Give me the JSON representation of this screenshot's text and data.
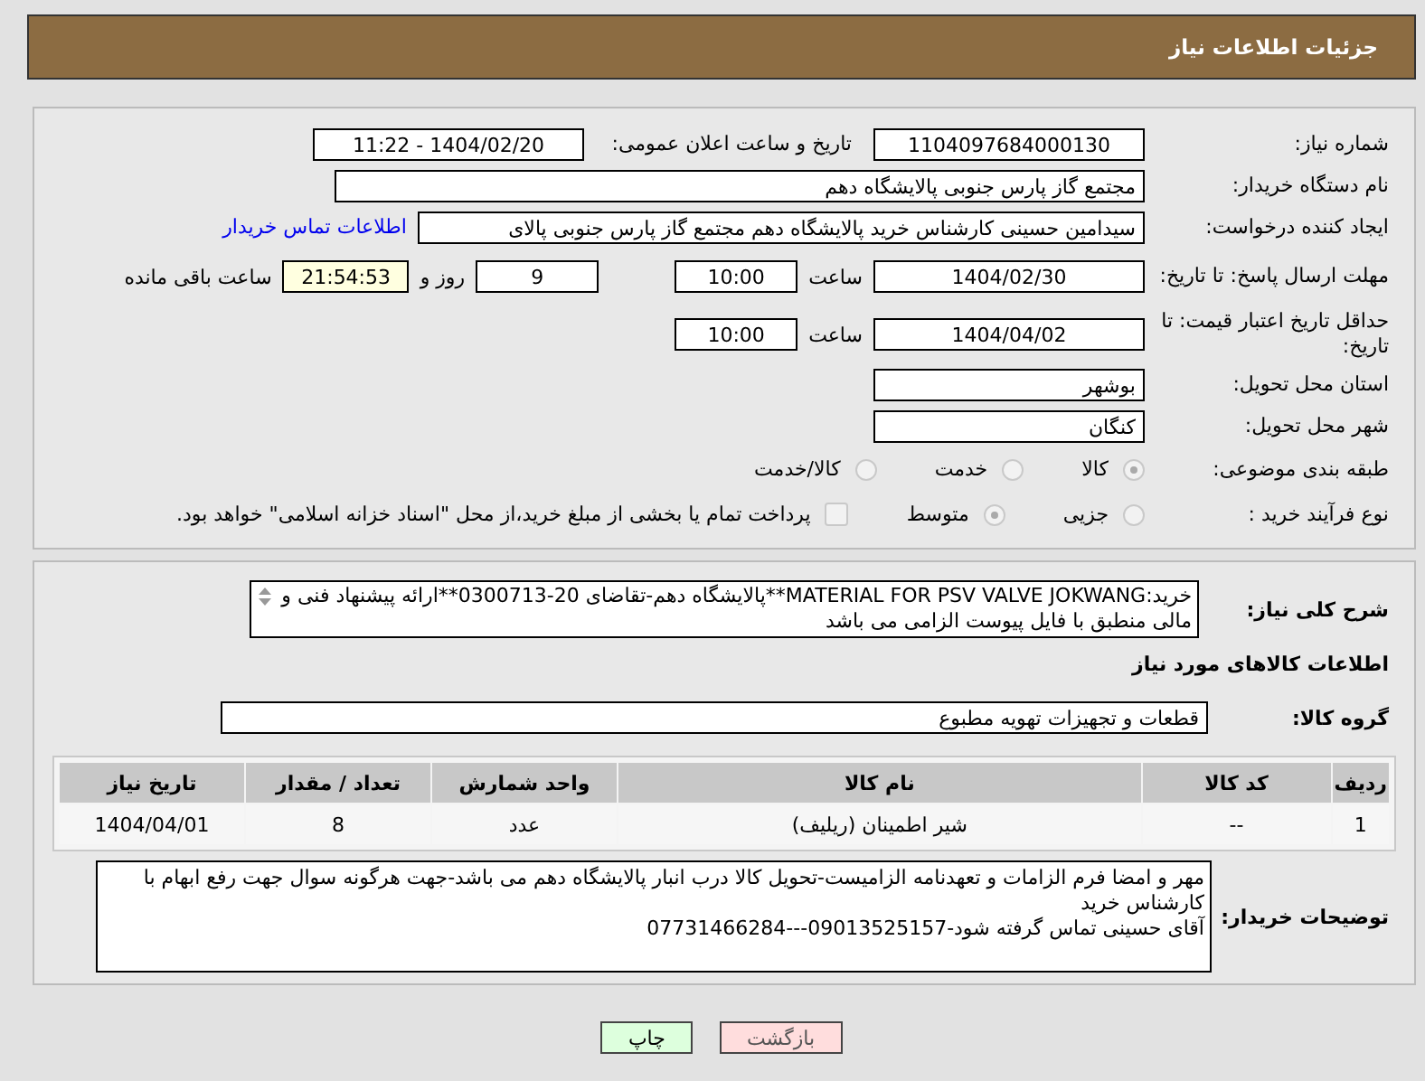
{
  "header": {
    "title": "جزئیات اطلاعات نیاز"
  },
  "need_number": {
    "label": "شماره نیاز:",
    "value": "1104097684000130"
  },
  "announce": {
    "label": "تاریخ و ساعت اعلان عمومی:",
    "value": "1404/02/20 - 11:22"
  },
  "buyer": {
    "label": "نام دستگاه خریدار:",
    "value": "مجتمع گاز پارس جنوبی  پالایشگاه دهم"
  },
  "creator": {
    "label": "ایجاد کننده درخواست:",
    "value": "سیدامین حسینی کارشناس خرید پالایشگاه دهم  مجتمع گاز پارس جنوبی  پالای",
    "link": "اطلاعات تماس خریدار"
  },
  "deadline": {
    "label": "مهلت ارسال پاسخ: تا تاریخ:",
    "date": "1404/02/30",
    "time_label": "ساعت",
    "time": "10:00",
    "days": "9",
    "days_label": "روز و",
    "remaining": "21:54:53",
    "remaining_label": "ساعت باقی مانده"
  },
  "validity": {
    "label": "حداقل تاریخ اعتبار قیمت: تا تاریخ:",
    "date": "1404/04/02",
    "time_label": "ساعت",
    "time": "10:00"
  },
  "province": {
    "label": "استان محل تحویل:",
    "value": "بوشهر"
  },
  "city": {
    "label": "شهر محل تحویل:",
    "value": "کنگان"
  },
  "category": {
    "label": "طبقه بندی موضوعی:",
    "options": [
      {
        "label": "کالا",
        "selected": true
      },
      {
        "label": "خدمت",
        "selected": false
      },
      {
        "label": "کالا/خدمت",
        "selected": false
      }
    ]
  },
  "process": {
    "label": "نوع فرآیند خرید :",
    "options": [
      {
        "label": "جزیی",
        "selected": false
      },
      {
        "label": "متوسط",
        "selected": true
      }
    ],
    "payment": {
      "checked": false,
      "label": "پرداخت تمام یا بخشی از مبلغ خرید،از محل \"اسناد خزانه اسلامی\" خواهد بود."
    }
  },
  "description": {
    "label": "شرح کلی نیاز:",
    "value": "خرید:MATERIAL FOR PSV VALVE JOKWANG**پالایشگاه دهم-تقاضای 20-0300713**ارائه پیشنهاد فنی و مالی منطبق با فایل پیوست الزامی می باشد"
  },
  "goods_title": "اطلاعات کالاهای مورد نیاز",
  "goods_group": {
    "label": "گروه کالا:",
    "value": "قطعات و تجهیزات تهویه مطبوع"
  },
  "table": {
    "columns": [
      "ردیف",
      "کد کالا",
      "نام کالا",
      "واحد شمارش",
      "تعداد / مقدار",
      "تاریخ نیاز"
    ],
    "rows": [
      [
        "1",
        "--",
        "شیر اطمینان (ریلیف)",
        "عدد",
        "8",
        "1404/04/01"
      ]
    ]
  },
  "notes": {
    "label": "توضیحات خریدار:",
    "value": "مهر و امضا فرم الزامات و تعهدنامه الزامیست-تحویل کالا درب انبار پالایشگاه دهم می باشد-جهت هرگونه سوال جهت رفع ابهام با کارشناس خرید\nآقای حسینی تماس گرفته شود-09013525157---07731466284"
  },
  "buttons": [
    {
      "label": "بازگشت",
      "kind": "back"
    },
    {
      "label": "چاپ",
      "kind": "print"
    }
  ]
}
